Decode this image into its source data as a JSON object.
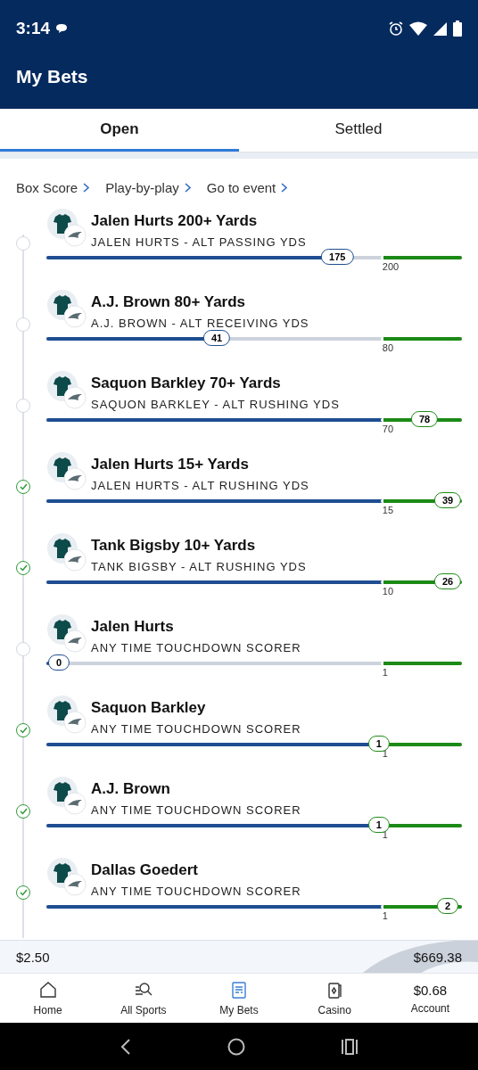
{
  "status_bar": {
    "time": "3:14"
  },
  "header": {
    "title": "My Bets"
  },
  "tabs": [
    {
      "label": "Open",
      "selected": true
    },
    {
      "label": "Settled",
      "selected": false
    }
  ],
  "event_links": [
    "Box Score",
    "Play-by-play",
    "Go to event"
  ],
  "bets": [
    {
      "title": "Jalen Hurts 200+ Yards",
      "subtitle": "JALEN HURTS - ALT PASSING YDS",
      "current": "175",
      "target": "200",
      "checked": false,
      "level": 0.7
    },
    {
      "title": "A.J. Brown 80+ Yards",
      "subtitle": "A.J. BROWN - ALT RECEIVING YDS",
      "current": "41",
      "target": "80",
      "checked": false,
      "level": 0.41
    },
    {
      "title": "Saquon Barkley 70+ Yards",
      "subtitle": "SAQUON BARKLEY - ALT RUSHING YDS",
      "current": "78",
      "target": "70",
      "checked": false,
      "level": 0.91
    },
    {
      "title": "Jalen Hurts 15+ Yards",
      "subtitle": "JALEN HURTS - ALT RUSHING YDS",
      "current": "39",
      "target": "15",
      "checked": true,
      "level": 0.97
    },
    {
      "title": "Tank Bigsby 10+ Yards",
      "subtitle": "TANK BIGSBY - ALT RUSHING YDS",
      "current": "26",
      "target": "10",
      "checked": true,
      "level": 0.97
    },
    {
      "title": "Jalen Hurts",
      "subtitle": "ANY TIME TOUCHDOWN SCORER",
      "current": "0",
      "target": "1",
      "checked": false,
      "level": 0.0
    },
    {
      "title": "Saquon Barkley",
      "subtitle": "ANY TIME TOUCHDOWN SCORER",
      "current": "1",
      "target": "1",
      "checked": true,
      "level": 0.8
    },
    {
      "title": "A.J. Brown",
      "subtitle": "ANY TIME TOUCHDOWN SCORER",
      "current": "1",
      "target": "1",
      "checked": true,
      "level": 0.8
    },
    {
      "title": "Dallas Goedert",
      "subtitle": "ANY TIME TOUCHDOWN SCORER",
      "current": "2",
      "target": "1",
      "checked": true,
      "level": 0.97
    }
  ],
  "summary": {
    "total_wager": "$2.50",
    "total_payout": "$669.38"
  },
  "nav": [
    {
      "kind": "home",
      "label": "Home",
      "selected": false
    },
    {
      "kind": "search",
      "label": "All Sports",
      "selected": false
    },
    {
      "kind": "bets",
      "label": "My Bets",
      "selected": true
    },
    {
      "kind": "casino",
      "label": "Casino",
      "selected": false
    },
    {
      "kind": "balance",
      "value": "$0.68",
      "label": "Account",
      "selected": false
    }
  ]
}
